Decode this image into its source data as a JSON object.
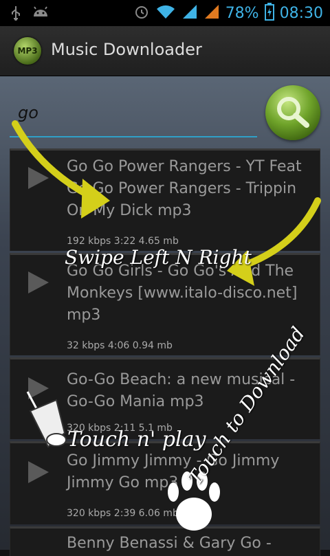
{
  "status_bar": {
    "battery_percent": "78%",
    "time": "08:30"
  },
  "header": {
    "title": "Music Downloader",
    "icon_label": "MP3"
  },
  "search": {
    "value": "go"
  },
  "results": [
    {
      "title": "Go Go Power Rangers - YT Feat Go Go Power Rangers - Trippin On My Dick mp3",
      "meta": "192 kbps 3:22 4.65 mb"
    },
    {
      "title": "Go Go Girls - Go Go's And The Monkeys [www.italo-disco.net] mp3",
      "meta": "32 kbps 4:06 0.94 mb"
    },
    {
      "title": "Go-Go Beach: a new musical - Go-Go Mania mp3",
      "meta": "320 kbps 2:11 5.1 mb"
    },
    {
      "title": "Go Jimmy Jimmy - Go Jimmy Jimmy Go mp3",
      "meta": "320 kbps 2:39 6.06 mb"
    },
    {
      "title": "Benny Benassi & Gary Go -",
      "meta": ""
    }
  ],
  "overlay": {
    "swipe_hint": "Swipe Left N Right",
    "touch_play_hint": "Touch n' play",
    "touch_download_hint": "Touch to Download"
  }
}
